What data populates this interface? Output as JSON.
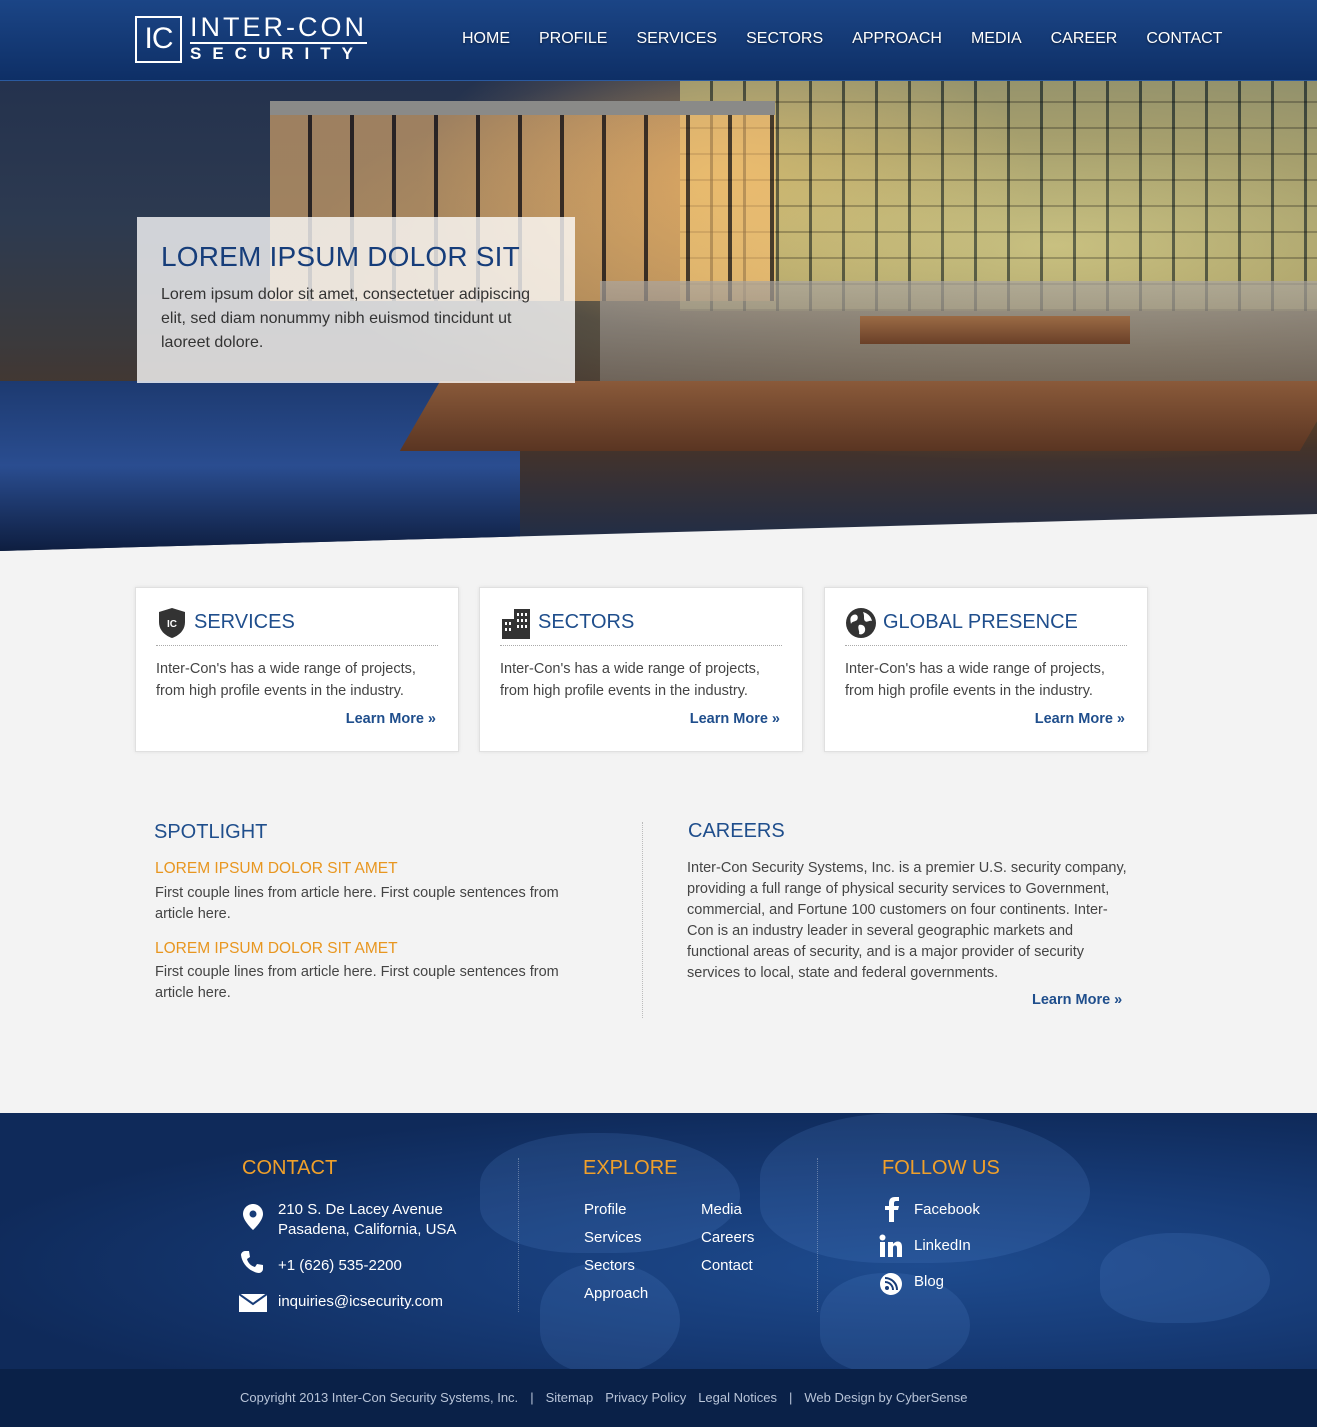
{
  "brand": {
    "logo_mark": "IC",
    "line1": "INTER-CON",
    "line2": "SECURITY"
  },
  "nav": {
    "items": [
      "HOME",
      "PROFILE",
      "SERVICES",
      "SECTORS",
      "APPROACH",
      "MEDIA",
      "CAREER",
      "CONTACT"
    ]
  },
  "hero": {
    "title": "LOREM IPSUM DOLOR SIT",
    "text": "Lorem ipsum dolor sit amet, consectetuer adipiscing elit, sed diam nonummy nibh euismod tincidunt ut laoreet dolore."
  },
  "cards": [
    {
      "icon": "shield-icon",
      "title": "SERVICES",
      "text": "Inter-Con's has a wide range of projects, from high profile events in the industry.",
      "more": "Learn More »"
    },
    {
      "icon": "building-icon",
      "title": "SECTORS",
      "text": "Inter-Con's has a wide range of projects, from high profile events in the industry.",
      "more": "Learn More »"
    },
    {
      "icon": "globe-icon",
      "title": "GLOBAL PRESENCE",
      "text": "Inter-Con's has a wide range of projects, from high profile events in the industry.",
      "more": "Learn More »"
    }
  ],
  "spotlight": {
    "title": "SPOTLIGHT",
    "items": [
      {
        "title": "LOREM IPSUM DOLOR SIT AMET",
        "text": "First couple lines from article here. First couple sentences from article here."
      },
      {
        "title": "LOREM IPSUM DOLOR SIT AMET",
        "text": "First couple lines from article here. First couple sentences from article here."
      }
    ]
  },
  "careers": {
    "title": "CAREERS",
    "text": "Inter-Con Security Systems, Inc. is a premier U.S. security company, providing a full range of physical security services to Government, commercial, and Fortune 100 customers on four continents.  Inter-Con is an industry leader in several geographic markets and functional areas of security, and is a major provider of security services to local, state and federal governments.",
    "more": "Learn More »"
  },
  "footer": {
    "contact": {
      "title": "CONTACT",
      "address_line1": "210 S. De Lacey Avenue",
      "address_line2": "Pasadena, California, USA",
      "phone": "+1 (626) 535-2200",
      "email": "inquiries@icsecurity.com"
    },
    "explore": {
      "title": "EXPLORE",
      "col1": [
        "Profile",
        "Services",
        "Sectors",
        "Approach"
      ],
      "col2": [
        "Media",
        "Careers",
        "Contact"
      ]
    },
    "follow": {
      "title": "FOLLOW US",
      "items": [
        "Facebook",
        "LinkedIn",
        "Blog"
      ]
    }
  },
  "bottom": {
    "copyright": "Copyright 2013 Inter-Con Security Systems, Inc.",
    "sep": "|",
    "links": [
      "Sitemap",
      "Privacy Policy",
      "Legal Notices"
    ],
    "credit": "Web Design by CyberSense"
  },
  "colors": {
    "brand_blue": "#1f4e8c",
    "accent_orange": "#e8961f",
    "footer_title": "#f0a02a"
  }
}
